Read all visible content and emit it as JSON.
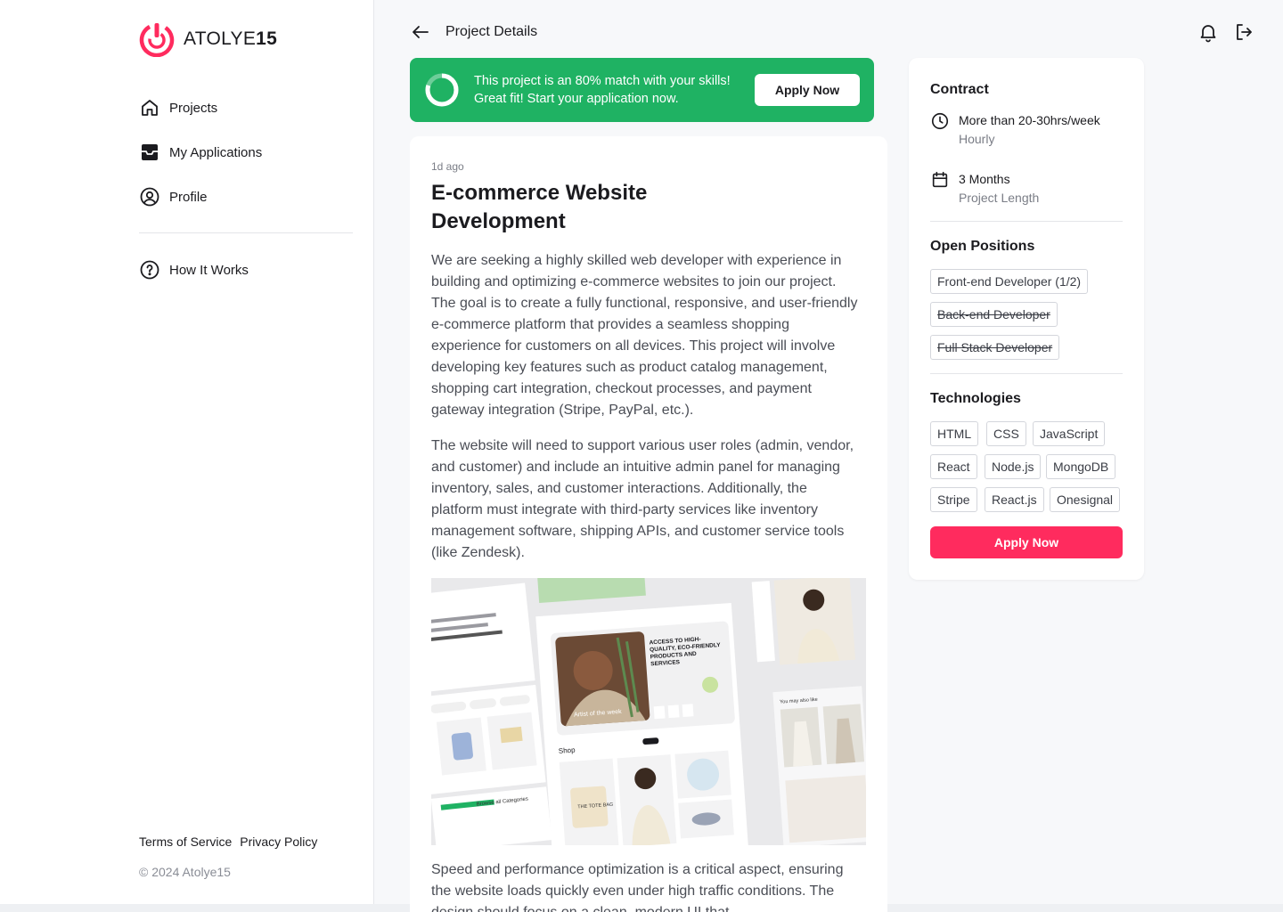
{
  "brand": {
    "name_regular": "ATOLYE",
    "name_bold": "15",
    "accent_color": "#ff2b5e"
  },
  "sidebar": {
    "items": [
      {
        "label": "Projects",
        "icon": "home-icon"
      },
      {
        "label": "My Applications",
        "icon": "inbox-icon"
      },
      {
        "label": "Profile",
        "icon": "user-circle-icon"
      }
    ],
    "secondary": [
      {
        "label": "How It Works",
        "icon": "help-circle-icon"
      }
    ],
    "footer": {
      "terms": "Terms of Service",
      "privacy": "Privacy Policy",
      "copyright": "© 2024 Atolye15"
    }
  },
  "header": {
    "title": "Project Details",
    "icons": [
      "arrow-left-icon",
      "bell-icon",
      "logout-icon"
    ]
  },
  "match_banner": {
    "text": "This project is an 80% match with your skills! Great fit! Start your application now.",
    "match_percent": 80,
    "button": "Apply Now",
    "color": "#1fb263"
  },
  "project": {
    "posted": "1d ago",
    "title": "E-commerce Website Development",
    "paragraphs": [
      "We are seeking a highly skilled web developer with experience in building and optimizing e-commerce websites to join our project. The goal is to create a fully functional, responsive, and user-friendly e-commerce platform that provides a seamless shopping experience for customers on all devices. This project will involve developing key features such as product catalog management, shopping cart integration, checkout processes, and payment gateway integration (Stripe, PayPal, etc.).",
      "The website will need to support various user roles (admin, vendor, and customer) and include an intuitive admin panel for managing inventory, sales, and customer interactions. Additionally, the platform must integrate with third-party services like inventory management software, shipping APIs, and customer service tools (like Zendesk).",
      "Speed and performance optimization is a critical aspect, ensuring the website loads quickly even under high traffic conditions. The design should focus on a clean, modern UI that"
    ],
    "mockup": {
      "hero_heading": "ACCESS TO HIGH-QUALITY, ECO-FRIENDLY PRODUCTS AND SERVICES",
      "artist_label": "Artist of the week",
      "shop_label": "Shop",
      "browse_label": "Browse all Categories",
      "tote_label": "THE TOTE BAG",
      "may_like": "You may also like"
    }
  },
  "details": {
    "contract_title": "Contract",
    "hours_main": "More than 20-30hrs/week",
    "hours_sub": "Hourly",
    "length_main": "3 Months",
    "length_sub": "Project Length",
    "positions_title": "Open Positions",
    "positions": [
      {
        "label": "Front-end Developer (1/2)",
        "closed": false
      },
      {
        "label": "Back-end Developer",
        "closed": true
      },
      {
        "label": "Full Stack Developer",
        "closed": true
      }
    ],
    "tech_title": "Technologies",
    "technologies": [
      "HTML",
      "CSS",
      "JavaScript",
      "React",
      "Node.js",
      "MongoDB",
      "Stripe",
      "React.js",
      "Onesignal"
    ],
    "apply_button": "Apply Now"
  }
}
